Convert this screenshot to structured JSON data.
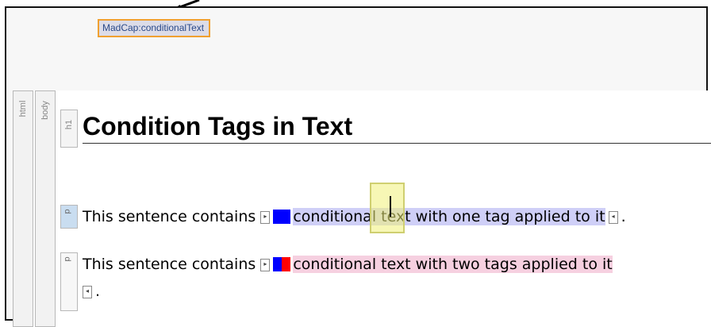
{
  "tooltip": {
    "text": "MadCap:conditionalText"
  },
  "structure": {
    "html_label": "html",
    "body_label": "body",
    "h1_label": "h1",
    "p_label": "p"
  },
  "heading": {
    "text": "Condition Tags in Text"
  },
  "para1": {
    "lead": "This sentence contains ",
    "conditional": "conditional text with one tag applied to it",
    "tail": "."
  },
  "para2": {
    "lead": "This sentence contains ",
    "conditional": "conditional text with two tags applied to it",
    "tail": "."
  },
  "colors": {
    "tag_blue": "#0000ff",
    "tag_red": "#ff0000",
    "cond_one_bg": "#cfcff7",
    "cond_two_bg": "#f6d0e0"
  }
}
